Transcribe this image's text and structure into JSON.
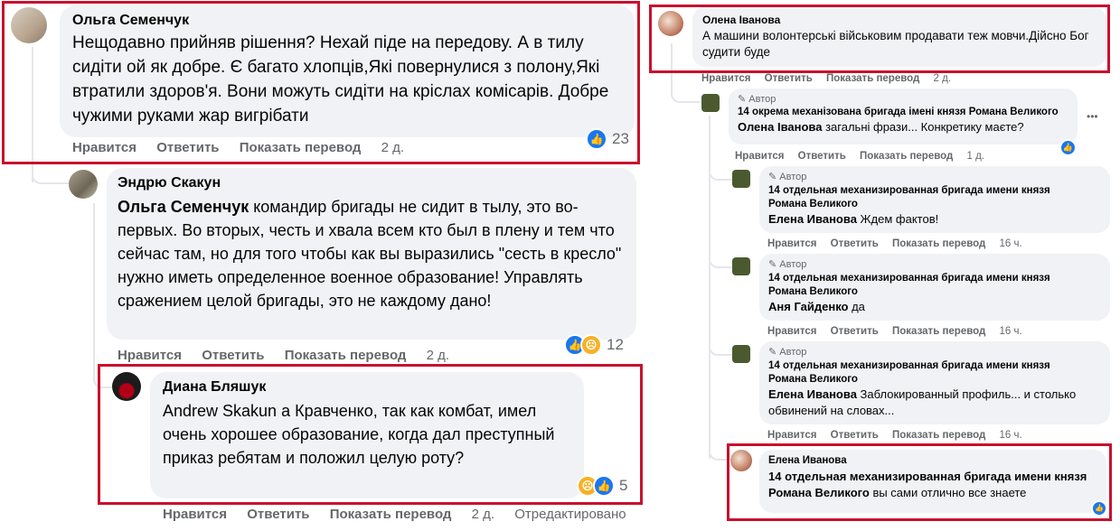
{
  "left": {
    "c1": {
      "name": "Ольга Семенчук",
      "text": "Нещодавно прийняв рішення? Нехай піде на передову. А в тилу сидіти ой як добре. Є багато хлопців,Які повернулися з полону,Які втратили здоров'я. Вони можуть сидіти на кріслах комісарів. Добре чужими руками жар вигрібати",
      "like": "Нравится",
      "reply": "Ответить",
      "translate": "Показать перевод",
      "time": "2 д.",
      "reactions": "23"
    },
    "c2": {
      "name": "Эндрю Скакун",
      "mention": "Ольга Семенчук",
      "text": " командир бригады не сидит в тылу, это во-первых. Во вторых, честь и хвала всем кто был в плену и тем что сейчас там, но для того чтобы как вы выразились \"сесть в кресло\" нужно иметь определенное военное образование! Управлять сражением целой бригады, это не каждому дано!",
      "like": "Нравится",
      "reply": "Ответить",
      "translate": "Показать перевод",
      "time": "2 д.",
      "reactions": "12"
    },
    "c3": {
      "name": "Диана Бляшук",
      "text": "Andrew Skakun а Кравченко, так как комбат, имел очень хорошее образование, когда дал преступный приказ ребятам и положил целую роту?",
      "like": "Нравится",
      "reply": "Ответить",
      "translate": "Показать перевод",
      "time": "2 д.",
      "edited": "Отредактировано",
      "reactions": "5"
    }
  },
  "right": {
    "c1": {
      "name": "Олена Іванова",
      "text": "А машини волонтерські військовим продавати теж мовчи.Дійсно Бог судити буде",
      "like": "Нравится",
      "reply": "Ответить",
      "translate": "Показать перевод",
      "time": "2 д."
    },
    "c2": {
      "badge": "Автор",
      "name": "14 окрема механізована бригада імені князя Романа Великого",
      "mention": "Олена Іванова",
      "text": " загальні фрази... Конкретику маєте?",
      "like": "Нравится",
      "reply": "Ответить",
      "translate": "Показать перевод",
      "time": "1 д.",
      "more": "•••"
    },
    "c3": {
      "badge": "Автор",
      "name": "14 отдельная механизированная бригада имени князя Романа Великого",
      "mention": "Елена Иванова",
      "text": " Ждем фактов!",
      "like": "Нравится",
      "reply": "Ответить",
      "translate": "Показать перевод",
      "time": "16 ч."
    },
    "c4": {
      "badge": "Автор",
      "name": "14 отдельная механизированная бригада имени князя Романа Великого",
      "mention": "Аня Гайденко",
      "text": " да",
      "like": "Нравится",
      "reply": "Ответить",
      "translate": "Показать перевод",
      "time": "16 ч."
    },
    "c5": {
      "badge": "Автор",
      "name": "14 отдельная механизированная бригада имени князя Романа Великого",
      "mention": "Елена Иванова",
      "text": " Заблокированный профиль... и столько обвинений на словах...",
      "like": "Нравится",
      "reply": "Ответить",
      "translate": "Показать перевод",
      "time": "16 ч."
    },
    "c6": {
      "name": "Елена Иванова",
      "mention": "14 отдельная механизированная бригада имени князя Романа Великого",
      "text": " вы сами отлично все знаете"
    }
  },
  "colors": {
    "highlight": "#c8102e",
    "bubble": "#f0f2f5",
    "like": "#1877f2",
    "meta": "#65676b"
  },
  "icons": [
    "thumbs-up-icon",
    "sad-face-icon",
    "pencil-icon",
    "more-icon"
  ]
}
